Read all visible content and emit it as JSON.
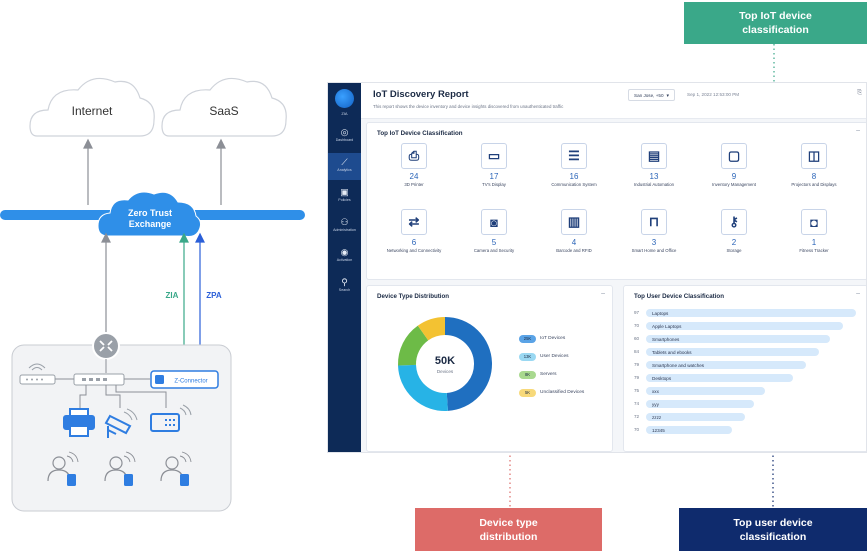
{
  "network": {
    "internet_label": "Internet",
    "saas_label": "SaaS",
    "zte_line1": "Zero Trust",
    "zte_line2": "Exchange",
    "zia_label": "ZIA",
    "zpa_label": "ZPA",
    "connector_label": "Z-Connector",
    "colors": {
      "zia": "#3aa889",
      "zpa": "#2a5fd8",
      "exchange": "#2f8fe8",
      "device": "#2f7de1"
    }
  },
  "dashboard": {
    "sidebar": {
      "logo_label": "ZIA",
      "items": [
        {
          "label": "Dashboard",
          "icon": "dashboard-icon"
        },
        {
          "label": "Analytics",
          "icon": "analytics-icon"
        },
        {
          "label": "Policies",
          "icon": "policies-icon"
        },
        {
          "label": "Administration",
          "icon": "administration-icon"
        },
        {
          "label": "Activation",
          "icon": "activation-icon"
        },
        {
          "label": "Search",
          "icon": "search-icon"
        }
      ]
    },
    "title": "IoT Discovery Report",
    "subtitle": "This report shows the device inventory and device insights discovered from unauthenticated traffic",
    "location": "San Jose, +50",
    "date": "Sep 1, 2022 12:53:00 PM",
    "iot_card": {
      "title": "Top IoT Device Classification",
      "tiles": [
        {
          "count": "24",
          "name": "3D Printer",
          "icon": "printer-icon"
        },
        {
          "count": "17",
          "name": "TV's Display",
          "icon": "monitor-icon"
        },
        {
          "count": "16",
          "name": "Communication System",
          "icon": "server-icon"
        },
        {
          "count": "13",
          "name": "Industrial Automation",
          "icon": "clipboard-icon"
        },
        {
          "count": "9",
          "name": "Inventory Management",
          "icon": "window-icon"
        },
        {
          "count": "8",
          "name": "Projectors and Displays",
          "icon": "projector-icon"
        },
        {
          "count": "6",
          "name": "Networking and Connectivity",
          "icon": "swap-icon"
        },
        {
          "count": "5",
          "name": "Camera and Security",
          "icon": "camera-icon"
        },
        {
          "count": "4",
          "name": "Barcode and RFID",
          "icon": "barcode-icon"
        },
        {
          "count": "3",
          "name": "Smart Home and Office",
          "icon": "lock-icon"
        },
        {
          "count": "2",
          "name": "Storage",
          "icon": "key-icon"
        },
        {
          "count": "1",
          "name": "Fitness Tracker",
          "icon": "watch-icon"
        }
      ]
    },
    "device_type": {
      "title": "Device Type Distribution",
      "center_value": "50K",
      "center_label": "Devices",
      "slices": [
        {
          "label": "IoT Devices",
          "badge": "25K",
          "value": 25,
          "color": "#1f6fc0",
          "badge_bg": "#5aa3e6"
        },
        {
          "label": "User Devices",
          "badge": "13K",
          "value": 13,
          "color": "#27b3e6",
          "badge_bg": "#9ad8f2"
        },
        {
          "label": "Servers",
          "badge": "8K",
          "value": 8,
          "color": "#6dbb47",
          "badge_bg": "#a9d98f"
        },
        {
          "label": "Unclassified Devices",
          "badge": "5K",
          "value": 5,
          "color": "#f3c232",
          "badge_bg": "#f7d97a"
        }
      ]
    },
    "top_user": {
      "title": "Top User Device Classification",
      "rows": [
        {
          "count": "97",
          "label": "Laptops",
          "value": 97
        },
        {
          "count": "70",
          "label": "Apple Laptops",
          "value": 91
        },
        {
          "count": "60",
          "label": "Smartphones",
          "value": 85
        },
        {
          "count": "84",
          "label": "Tablets and ebooks",
          "value": 80
        },
        {
          "count": "79",
          "label": "Smartphone and watches",
          "value": 74
        },
        {
          "count": "79",
          "label": "Desktops",
          "value": 68
        },
        {
          "count": "75",
          "label": "xxx",
          "value": 55
        },
        {
          "count": "74",
          "label": "yyy",
          "value": 50
        },
        {
          "count": "72",
          "label": "zzzz",
          "value": 46
        },
        {
          "count": "70",
          "label": "12345",
          "value": 40
        }
      ]
    }
  },
  "callouts": {
    "iot": {
      "line1": "Top IoT device",
      "line2": "classification",
      "color": "#3aa889"
    },
    "device": {
      "line1": "Device type",
      "line2": "distribution",
      "color": "#dd6b68"
    },
    "user": {
      "line1": "Top user device",
      "line2": "classification",
      "color": "#0f2b6d"
    }
  }
}
